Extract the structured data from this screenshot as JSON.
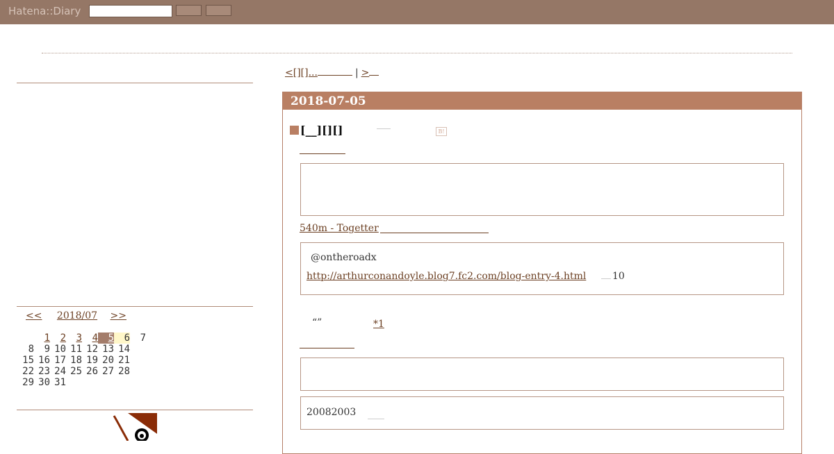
{
  "header": {
    "logo": "Hatena::Diary",
    "search_value": "",
    "button1_label": "",
    "button2_label": ""
  },
  "pager": {
    "prev": "<[][]...",
    "sep": "|",
    "next": ">"
  },
  "calendar": {
    "prev": "<<",
    "month": "2018/07",
    "next": ">>",
    "weeks": [
      [
        "",
        "1",
        "2",
        "3",
        "4",
        "5",
        "6",
        "7"
      ],
      [
        "8",
        "9",
        "10",
        "11",
        "12",
        "13",
        "14"
      ],
      [
        "15",
        "16",
        "17",
        "18",
        "19",
        "20",
        "21"
      ],
      [
        "22",
        "23",
        "24",
        "25",
        "26",
        "27",
        "28"
      ],
      [
        "29",
        "30",
        "31"
      ]
    ],
    "selected_day": "5",
    "today": "6"
  },
  "day": {
    "date": "2018-07-05",
    "section_title": "[__][][]",
    "togetter_link": "540m - Togetter",
    "quote_user": "@ontheroadx",
    "quote_link": "http://arthurconandoyle.blog7.fc2.com/blog-entry-4.html",
    "quote_num": "10",
    "quotes_text": "“”",
    "footnote": "*1",
    "text_2008": "20082003"
  },
  "colors": {
    "topbar": "#957766",
    "accent": "#b97f63"
  }
}
